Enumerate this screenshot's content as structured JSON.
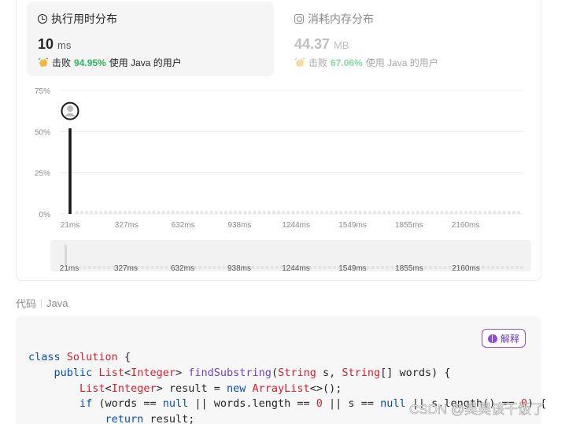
{
  "runtime": {
    "title": "执行用时分布",
    "value": "10",
    "unit": "ms",
    "beats_prefix": "击败",
    "beats_pct": "94.95%",
    "beats_suffix": "使用 Java 的用户"
  },
  "memory": {
    "title": "消耗内存分布",
    "value": "44.37",
    "unit": "MB",
    "beats_prefix": "击败",
    "beats_pct": "67.06%",
    "beats_suffix": "使用 Java 的用户"
  },
  "chart_data": {
    "type": "bar",
    "y_ticks": [
      "75%",
      "50%",
      "25%",
      "0%"
    ],
    "x_ticks": [
      "21ms",
      "327ms",
      "632ms",
      "938ms",
      "1244ms",
      "1549ms",
      "1855ms",
      "2160ms"
    ],
    "values_percent": [
      {
        "x": "21ms",
        "y": 52
      }
    ],
    "ylim": [
      0,
      75
    ],
    "highlight": "21ms",
    "brush_ticks": [
      "21ms",
      "327ms",
      "632ms",
      "938ms",
      "1244ms",
      "1549ms",
      "1855ms",
      "2160ms"
    ]
  },
  "code_section": {
    "label": "代码",
    "language": "Java",
    "explain_label": "解释"
  },
  "code_lines": [
    "class Solution {",
    "    public List<Integer> findSubstring(String s, String[] words) {",
    "        List<Integer> result = new ArrayList<>();",
    "        if (words == null || words.length == 0 || s == null || s.length() == 0) {",
    "            return result;"
  ],
  "watermark": "CSDN @昊昊该干饭了",
  "colors": {
    "accent_green": "#2db55d",
    "bar": "#1a1a1a",
    "explain_purple": "#8a4dd8"
  }
}
